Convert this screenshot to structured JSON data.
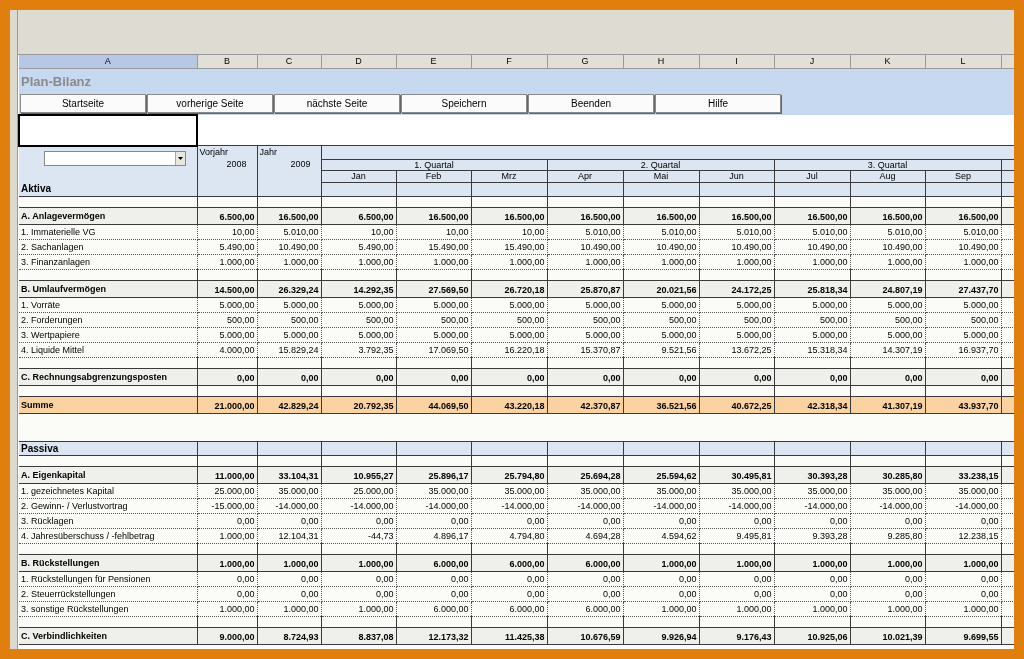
{
  "column_headers": [
    {
      "label": "A",
      "selected": true
    },
    {
      "label": "B",
      "selected": false
    },
    {
      "label": "C",
      "selected": false
    },
    {
      "label": "D",
      "selected": false
    },
    {
      "label": "E",
      "selected": false
    },
    {
      "label": "F",
      "selected": false
    },
    {
      "label": "G",
      "selected": false
    },
    {
      "label": "H",
      "selected": false
    },
    {
      "label": "I",
      "selected": false
    },
    {
      "label": "J",
      "selected": false
    },
    {
      "label": "K",
      "selected": false
    },
    {
      "label": "L",
      "selected": false
    }
  ],
  "title": "Plan-Bilanz",
  "buttons": [
    "Startseite",
    "vorherige Seite",
    "nächste Seite",
    "Speichern",
    "Beenden",
    "Hilfe"
  ],
  "header": {
    "prev_year": {
      "label": "Vorjahr",
      "year": "2008"
    },
    "year": {
      "label": "Jahr",
      "year": "2009"
    },
    "quarters": [
      "1. Quartal",
      "2. Quartal",
      "3. Quartal"
    ],
    "months": [
      "Jan",
      "Feb",
      "Mrz",
      "Apr",
      "Mai",
      "Jun",
      "Jul",
      "Aug",
      "Sep"
    ]
  },
  "rows": [
    {
      "kind": "section",
      "label": "Aktiva"
    },
    {
      "kind": "blank"
    },
    {
      "kind": "group",
      "label": "A. Anlagevermögen",
      "values": [
        "6.500,00",
        "16.500,00",
        "6.500,00",
        "16.500,00",
        "16.500,00",
        "16.500,00",
        "16.500,00",
        "16.500,00",
        "16.500,00",
        "16.500,00",
        "16.500,00"
      ]
    },
    {
      "kind": "item",
      "label": "1. Immaterielle VG",
      "values": [
        "10,00",
        "5.010,00",
        "10,00",
        "10,00",
        "10,00",
        "5.010,00",
        "5.010,00",
        "5.010,00",
        "5.010,00",
        "5.010,00",
        "5.010,00"
      ]
    },
    {
      "kind": "item",
      "label": "2. Sachanlagen",
      "values": [
        "5.490,00",
        "10.490,00",
        "5.490,00",
        "15.490,00",
        "15.490,00",
        "10.490,00",
        "10.490,00",
        "10.490,00",
        "10.490,00",
        "10.490,00",
        "10.490,00"
      ]
    },
    {
      "kind": "item",
      "label": "3. Finanzanlagen",
      "values": [
        "1.000,00",
        "1.000,00",
        "1.000,00",
        "1.000,00",
        "1.000,00",
        "1.000,00",
        "1.000,00",
        "1.000,00",
        "1.000,00",
        "1.000,00",
        "1.000,00"
      ]
    },
    {
      "kind": "blank"
    },
    {
      "kind": "group",
      "label": "B. Umlaufvermögen",
      "values": [
        "14.500,00",
        "26.329,24",
        "14.292,35",
        "27.569,50",
        "26.720,18",
        "25.870,87",
        "20.021,56",
        "24.172,25",
        "25.818,34",
        "24.807,19",
        "27.437,70"
      ]
    },
    {
      "kind": "item",
      "label": "1. Vorräte",
      "values": [
        "5.000,00",
        "5.000,00",
        "5.000,00",
        "5.000,00",
        "5.000,00",
        "5.000,00",
        "5.000,00",
        "5.000,00",
        "5.000,00",
        "5.000,00",
        "5.000,00"
      ]
    },
    {
      "kind": "item",
      "label": "2. Forderungen",
      "values": [
        "500,00",
        "500,00",
        "500,00",
        "500,00",
        "500,00",
        "500,00",
        "500,00",
        "500,00",
        "500,00",
        "500,00",
        "500,00"
      ]
    },
    {
      "kind": "item",
      "label": "3. Wertpapiere",
      "values": [
        "5.000,00",
        "5.000,00",
        "5.000,00",
        "5.000,00",
        "5.000,00",
        "5.000,00",
        "5.000,00",
        "5.000,00",
        "5.000,00",
        "5.000,00",
        "5.000,00"
      ]
    },
    {
      "kind": "item",
      "label": "4. Liquide Mittel",
      "values": [
        "4.000,00",
        "15.829,24",
        "3.792,35",
        "17.069,50",
        "16.220,18",
        "15.370,87",
        "9.521,56",
        "13.672,25",
        "15.318,34",
        "14.307,19",
        "16.937,70"
      ]
    },
    {
      "kind": "blank"
    },
    {
      "kind": "group",
      "label": "C. Rechnungsabgrenzungsposten",
      "values": [
        "0,00",
        "0,00",
        "0,00",
        "0,00",
        "0,00",
        "0,00",
        "0,00",
        "0,00",
        "0,00",
        "0,00",
        "0,00"
      ]
    },
    {
      "kind": "blank"
    },
    {
      "kind": "sum",
      "label": "Summe",
      "values": [
        "21.000,00",
        "42.829,24",
        "20.792,35",
        "44.069,50",
        "43.220,18",
        "42.370,87",
        "36.521,56",
        "40.672,25",
        "42.318,34",
        "41.307,19",
        "43.937,70"
      ]
    },
    {
      "kind": "gap"
    },
    {
      "kind": "section",
      "label": "Passiva"
    },
    {
      "kind": "blank"
    },
    {
      "kind": "group",
      "label": "A. Eigenkapital",
      "values": [
        "11.000,00",
        "33.104,31",
        "10.955,27",
        "25.896,17",
        "25.794,80",
        "25.694,28",
        "25.594,62",
        "30.495,81",
        "30.393,28",
        "30.285,80",
        "33.238,15"
      ]
    },
    {
      "kind": "item",
      "label": "1. gezeichnetes Kapital",
      "values": [
        "25.000,00",
        "35.000,00",
        "25.000,00",
        "35.000,00",
        "35.000,00",
        "35.000,00",
        "35.000,00",
        "35.000,00",
        "35.000,00",
        "35.000,00",
        "35.000,00"
      ]
    },
    {
      "kind": "item",
      "label": "2. Gewinn- / Verlustvortrag",
      "values": [
        "-15.000,00",
        "-14.000,00",
        "-14.000,00",
        "-14.000,00",
        "-14.000,00",
        "-14.000,00",
        "-14.000,00",
        "-14.000,00",
        "-14.000,00",
        "-14.000,00",
        "-14.000,00"
      ]
    },
    {
      "kind": "item",
      "label": "3. Rücklagen",
      "values": [
        "0,00",
        "0,00",
        "0,00",
        "0,00",
        "0,00",
        "0,00",
        "0,00",
        "0,00",
        "0,00",
        "0,00",
        "0,00"
      ]
    },
    {
      "kind": "item",
      "label": "4. Jahresüberschuss / -fehlbetrag",
      "values": [
        "1.000,00",
        "12.104,31",
        "-44,73",
        "4.896,17",
        "4.794,80",
        "4.694,28",
        "4.594,62",
        "9.495,81",
        "9.393,28",
        "9.285,80",
        "12.238,15"
      ]
    },
    {
      "kind": "blank"
    },
    {
      "kind": "group",
      "label": "B. Rückstellungen",
      "values": [
        "1.000,00",
        "1.000,00",
        "1.000,00",
        "6.000,00",
        "6.000,00",
        "6.000,00",
        "1.000,00",
        "1.000,00",
        "1.000,00",
        "1.000,00",
        "1.000,00"
      ]
    },
    {
      "kind": "item",
      "label": "1. Rückstellungen für Pensionen",
      "values": [
        "0,00",
        "0,00",
        "0,00",
        "0,00",
        "0,00",
        "0,00",
        "0,00",
        "0,00",
        "0,00",
        "0,00",
        "0,00"
      ]
    },
    {
      "kind": "item",
      "label": "2. Steuerrückstellungen",
      "values": [
        "0,00",
        "0,00",
        "0,00",
        "0,00",
        "0,00",
        "0,00",
        "0,00",
        "0,00",
        "0,00",
        "0,00",
        "0,00"
      ]
    },
    {
      "kind": "item",
      "label": "3. sonstige Rückstellungen",
      "values": [
        "1.000,00",
        "1.000,00",
        "1.000,00",
        "6.000,00",
        "6.000,00",
        "6.000,00",
        "1.000,00",
        "1.000,00",
        "1.000,00",
        "1.000,00",
        "1.000,00"
      ]
    },
    {
      "kind": "blank"
    },
    {
      "kind": "group",
      "label": "C. Verbindlichkeiten",
      "values": [
        "9.000,00",
        "8.724,93",
        "8.837,08",
        "12.173,32",
        "11.425,38",
        "10.676,59",
        "9.926,94",
        "9.176,43",
        "10.925,06",
        "10.021,39",
        "9.699,55"
      ]
    }
  ]
}
